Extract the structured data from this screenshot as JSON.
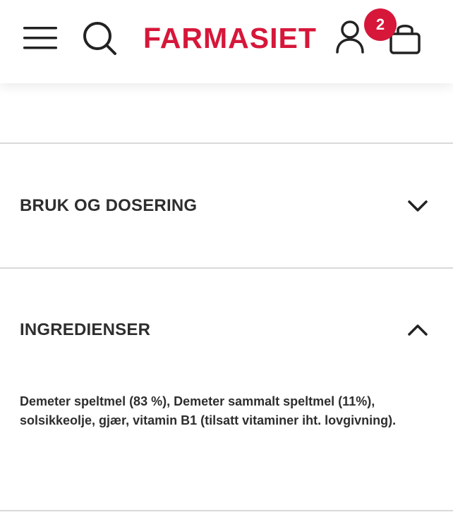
{
  "header": {
    "logo_text": "FARMASIET",
    "cart_count": "2",
    "menu_icon": "hamburger-menu-icon",
    "search_icon": "search-icon",
    "account_icon": "user-account-icon",
    "cart_icon": "shopping-bag-icon",
    "brand_color": "#d6173a"
  },
  "accordion": {
    "sections": [
      {
        "title": "BRUK OG DOSERING",
        "expanded": false,
        "icon": "chevron-down-icon"
      },
      {
        "title": "INGREDIENSER",
        "expanded": true,
        "icon": "chevron-up-icon",
        "content": "Demeter speltmel (83 %), Demeter sammalt speltmel (11%), solsikkeolje, gjær, vitamin B1 (tilsatt vitaminer iht. lovgivning)."
      }
    ]
  }
}
